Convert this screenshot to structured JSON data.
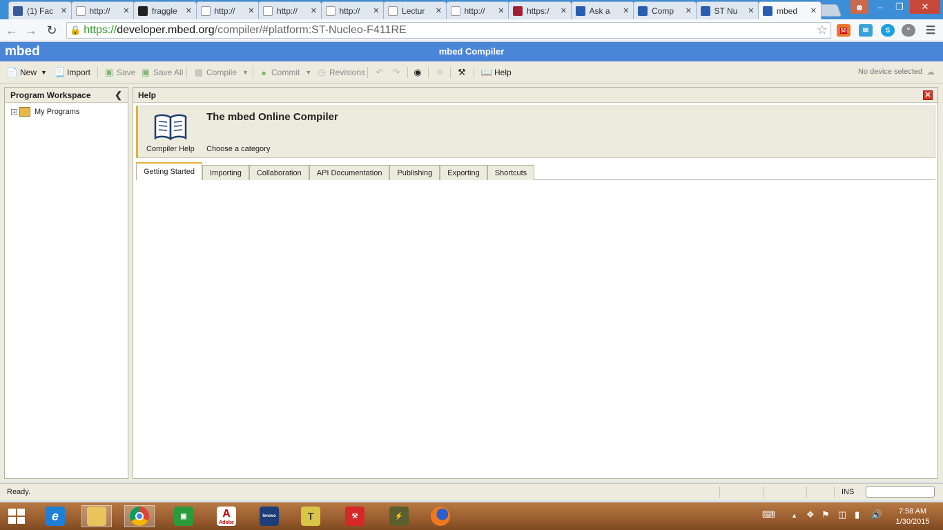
{
  "browser": {
    "tabs": [
      {
        "title": "(1) Fac",
        "icon": "facebook-icon",
        "color": "#3b5998"
      },
      {
        "title": "http://",
        "icon": "page-icon",
        "color": "#ffffff"
      },
      {
        "title": "fraggle",
        "icon": "github-icon",
        "color": "#222222"
      },
      {
        "title": "http://",
        "icon": "page-icon",
        "color": "#ffffff"
      },
      {
        "title": "http://",
        "icon": "page-icon",
        "color": "#ffffff"
      },
      {
        "title": "http://",
        "icon": "page-icon",
        "color": "#ffffff"
      },
      {
        "title": "Lectur",
        "icon": "edx-icon",
        "color": "#ffffff"
      },
      {
        "title": "http://",
        "icon": "page-icon",
        "color": "#ffffff"
      },
      {
        "title": "https:/",
        "icon": "mit-icon",
        "color": "#a31f34"
      },
      {
        "title": "Ask a",
        "icon": "mbed-icon",
        "color": "#2a5db0"
      },
      {
        "title": "Comp",
        "icon": "mbed-icon",
        "color": "#2a5db0"
      },
      {
        "title": "ST Nu",
        "icon": "mbed-icon",
        "color": "#2a5db0"
      },
      {
        "title": "mbed",
        "icon": "mbed-icon",
        "color": "#2a5db0"
      }
    ],
    "url_scheme": "https://",
    "url_host": "developer.mbed.org",
    "url_path": "/compiler/#platform:ST-Nucleo-F411RE",
    "rss_badge": "50"
  },
  "header": {
    "logo": "mbed",
    "title": "mbed Compiler"
  },
  "toolbar": {
    "new": "New",
    "import": "Import",
    "save": "Save",
    "save_all": "Save All",
    "compile": "Compile",
    "commit": "Commit",
    "revisions": "Revisions",
    "help": "Help",
    "device": "No device selected"
  },
  "workspace": {
    "title": "Program Workspace",
    "root": "My Programs"
  },
  "help": {
    "panel_title": "Help",
    "caption": "Compiler Help",
    "title": "The mbed Online Compiler",
    "subtitle": "Choose a category",
    "tabs": [
      "Getting Started",
      "Importing",
      "Collaboration",
      "API Documentation",
      "Publishing",
      "Exporting",
      "Shortcuts"
    ]
  },
  "status": {
    "text": "Ready.",
    "mode": "INS"
  },
  "clock": {
    "time": "7:58 AM",
    "date": "1/30/2015"
  },
  "taskbar": {
    "adobe_label": "Adobe",
    "lenovo_label": "lenovo"
  }
}
